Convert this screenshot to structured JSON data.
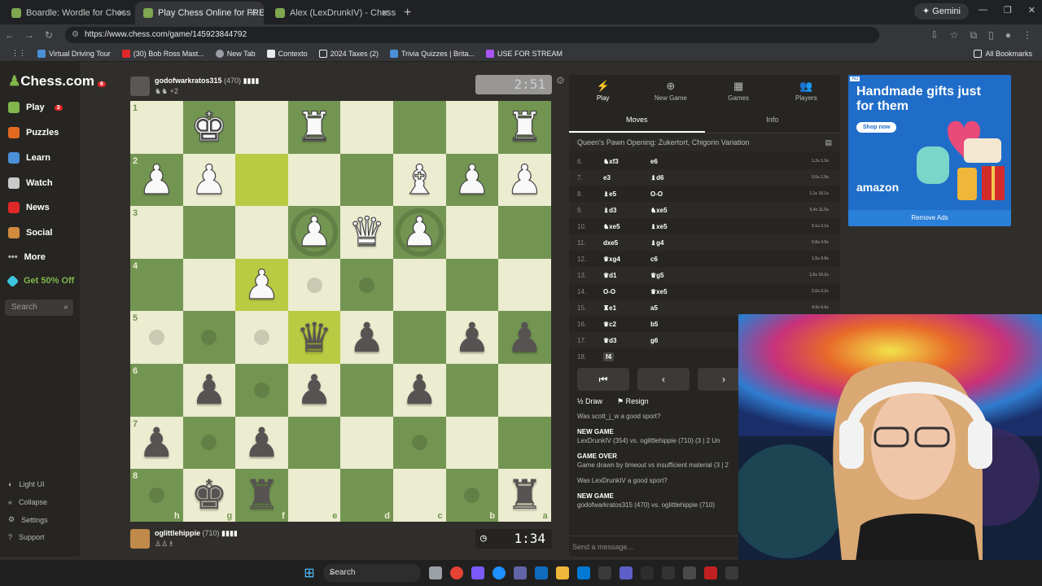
{
  "browser": {
    "tabs": [
      {
        "title": "Boardle: Wordle for Chess Puzz",
        "active": false
      },
      {
        "title": "Play Chess Online for FREE - 2 F",
        "active": true
      },
      {
        "title": "Alex (LexDrunkIV) - Chess Profi",
        "active": false
      }
    ],
    "gemini_label": "Gemini",
    "url": "https://www.chess.com/game/145923844792",
    "bookmarks": [
      "Virtual Driving Tour",
      "(30) Bob Ross Mast...",
      "New Tab",
      "Contexto",
      "2024 Taxes (2)",
      "Trivia Quizzes | Brita...",
      "USE FOR STREAM"
    ],
    "all_bookmarks": "All Bookmarks"
  },
  "sidebar": {
    "logo": "Chess.com",
    "logo_badge": "6",
    "items": [
      {
        "label": "Play",
        "badge": "3",
        "color": "#81b64c"
      },
      {
        "label": "Puzzles",
        "badge": "",
        "color": "#e36a21"
      },
      {
        "label": "Learn",
        "badge": "",
        "color": "#4b8fd6"
      },
      {
        "label": "Watch",
        "badge": "",
        "color": "#c9c9c9"
      },
      {
        "label": "News",
        "badge": "",
        "color": "#e02828"
      },
      {
        "label": "Social",
        "badge": "",
        "color": "#d18a3e"
      },
      {
        "label": "More",
        "badge": "",
        "color": "#8b8987"
      }
    ],
    "promo": "Get 50% Off",
    "search_placeholder": "Search",
    "bottom": [
      "Light UI",
      "Collapse",
      "Settings",
      "Support"
    ]
  },
  "top_player": {
    "name": "godofwarkratos315",
    "rating": "(470)",
    "captured": "+2",
    "clock": "2:51"
  },
  "bottom_player": {
    "name": "oglittlehippie",
    "rating": "(710)",
    "clock": "1:34"
  },
  "board": {
    "ranks": [
      "1",
      "2",
      "3",
      "4",
      "5",
      "6",
      "7",
      "8"
    ],
    "files": [
      "h",
      "g",
      "f",
      "e",
      "d",
      "c",
      "b",
      "a"
    ],
    "pieces": [
      [
        "",
        "wK",
        "",
        "wR",
        "",
        "",
        "",
        "wR"
      ],
      [
        "wP",
        "wP",
        "",
        "",
        "",
        "wB",
        "wP",
        "wP"
      ],
      [
        "",
        "",
        "",
        "wP",
        "wQ",
        "wP",
        "",
        ""
      ],
      [
        "",
        "",
        "wP",
        "",
        "",
        "",
        "",
        ""
      ],
      [
        "",
        "",
        "",
        "bQ",
        "bP",
        "",
        "bP",
        "bP"
      ],
      [
        "",
        "bP",
        "",
        "bP",
        "",
        "bP",
        "",
        ""
      ],
      [
        "bP",
        "",
        "bP",
        "",
        "",
        "",
        "",
        ""
      ],
      [
        "",
        "bK",
        "bR",
        "",
        "",
        "",
        "",
        "bR"
      ]
    ],
    "highlight": [
      [
        1,
        2
      ],
      [
        3,
        2
      ],
      [
        4,
        3
      ]
    ],
    "dots": [
      [
        3,
        3
      ],
      [
        3,
        4
      ],
      [
        4,
        0
      ],
      [
        4,
        1
      ],
      [
        4,
        2
      ],
      [
        5,
        2
      ],
      [
        6,
        1
      ],
      [
        6,
        5
      ],
      [
        7,
        0
      ],
      [
        7,
        6
      ]
    ],
    "rings": [
      [
        2,
        3
      ],
      [
        2,
        5
      ]
    ]
  },
  "panel": {
    "tabs": [
      {
        "label": "Play",
        "icon": "⚡"
      },
      {
        "label": "New Game",
        "icon": "⊕"
      },
      {
        "label": "Games",
        "icon": "▦"
      },
      {
        "label": "Players",
        "icon": "👥"
      }
    ],
    "subtabs": [
      "Moves",
      "Info"
    ],
    "opening": "Queen's Pawn Opening: Zukertort, Chigorin Variation",
    "moves": [
      {
        "n": "6.",
        "w": "♞xf3",
        "b": "e6",
        "t": "1.2s 1.3s"
      },
      {
        "n": "7.",
        "w": "e3",
        "b": "♝d6",
        "t": "0.6s 1.9s"
      },
      {
        "n": "8.",
        "w": "♝e5",
        "b": "O-O",
        "t": "1.1s 16.1s"
      },
      {
        "n": "9.",
        "w": "♝d3",
        "b": "♞xe5",
        "t": "5.4s 11.5s"
      },
      {
        "n": "10.",
        "w": "♞xe5",
        "b": "♝xe5",
        "t": "5.1s 2.1s"
      },
      {
        "n": "11.",
        "w": "dxe5",
        "b": "♝g4",
        "t": "0.8s 4.9s"
      },
      {
        "n": "12.",
        "w": "♛xg4",
        "b": "c6",
        "t": "1.5s 9.8s"
      },
      {
        "n": "13.",
        "w": "♛d1",
        "b": "♛g5",
        "t": "1.6s 10.2s"
      },
      {
        "n": "14.",
        "w": "O-O",
        "b": "♛xe5",
        "t": "2.6s 2.2s"
      },
      {
        "n": "15.",
        "w": "♜e1",
        "b": "a5",
        "t": "4.9s 6.6s"
      },
      {
        "n": "16.",
        "w": "♛c2",
        "b": "b5",
        "t": ""
      },
      {
        "n": "17.",
        "w": "♛d3",
        "b": "g6",
        "t": ""
      },
      {
        "n": "18.",
        "w": "f4",
        "b": "",
        "t": ""
      }
    ],
    "draw_label": "Draw",
    "resign_label": "Resign",
    "chat": [
      {
        "head": "",
        "text": "Was scott_j_w a good sport?"
      },
      {
        "head": "NEW GAME",
        "text": "LexDrunkIV (354) vs. oglittlehippie (710) (3 | 2 Un"
      },
      {
        "head": "GAME OVER",
        "text": "Game drawn by timeout vs insufficient material (3 | 2"
      },
      {
        "head": "",
        "text": "Was LexDrunkIV a good sport?"
      },
      {
        "head": "NEW GAME",
        "text": "godofwarkratos315 (470) vs. oglittlehippie (710)"
      }
    ],
    "chat_placeholder": "Send a message..."
  },
  "ad": {
    "tag": "AD",
    "headline": "Handmade gifts just for them",
    "cta": "Shop now",
    "brand": "amazon",
    "remove": "Remove Ads"
  },
  "taskbar": {
    "search": "Search"
  }
}
